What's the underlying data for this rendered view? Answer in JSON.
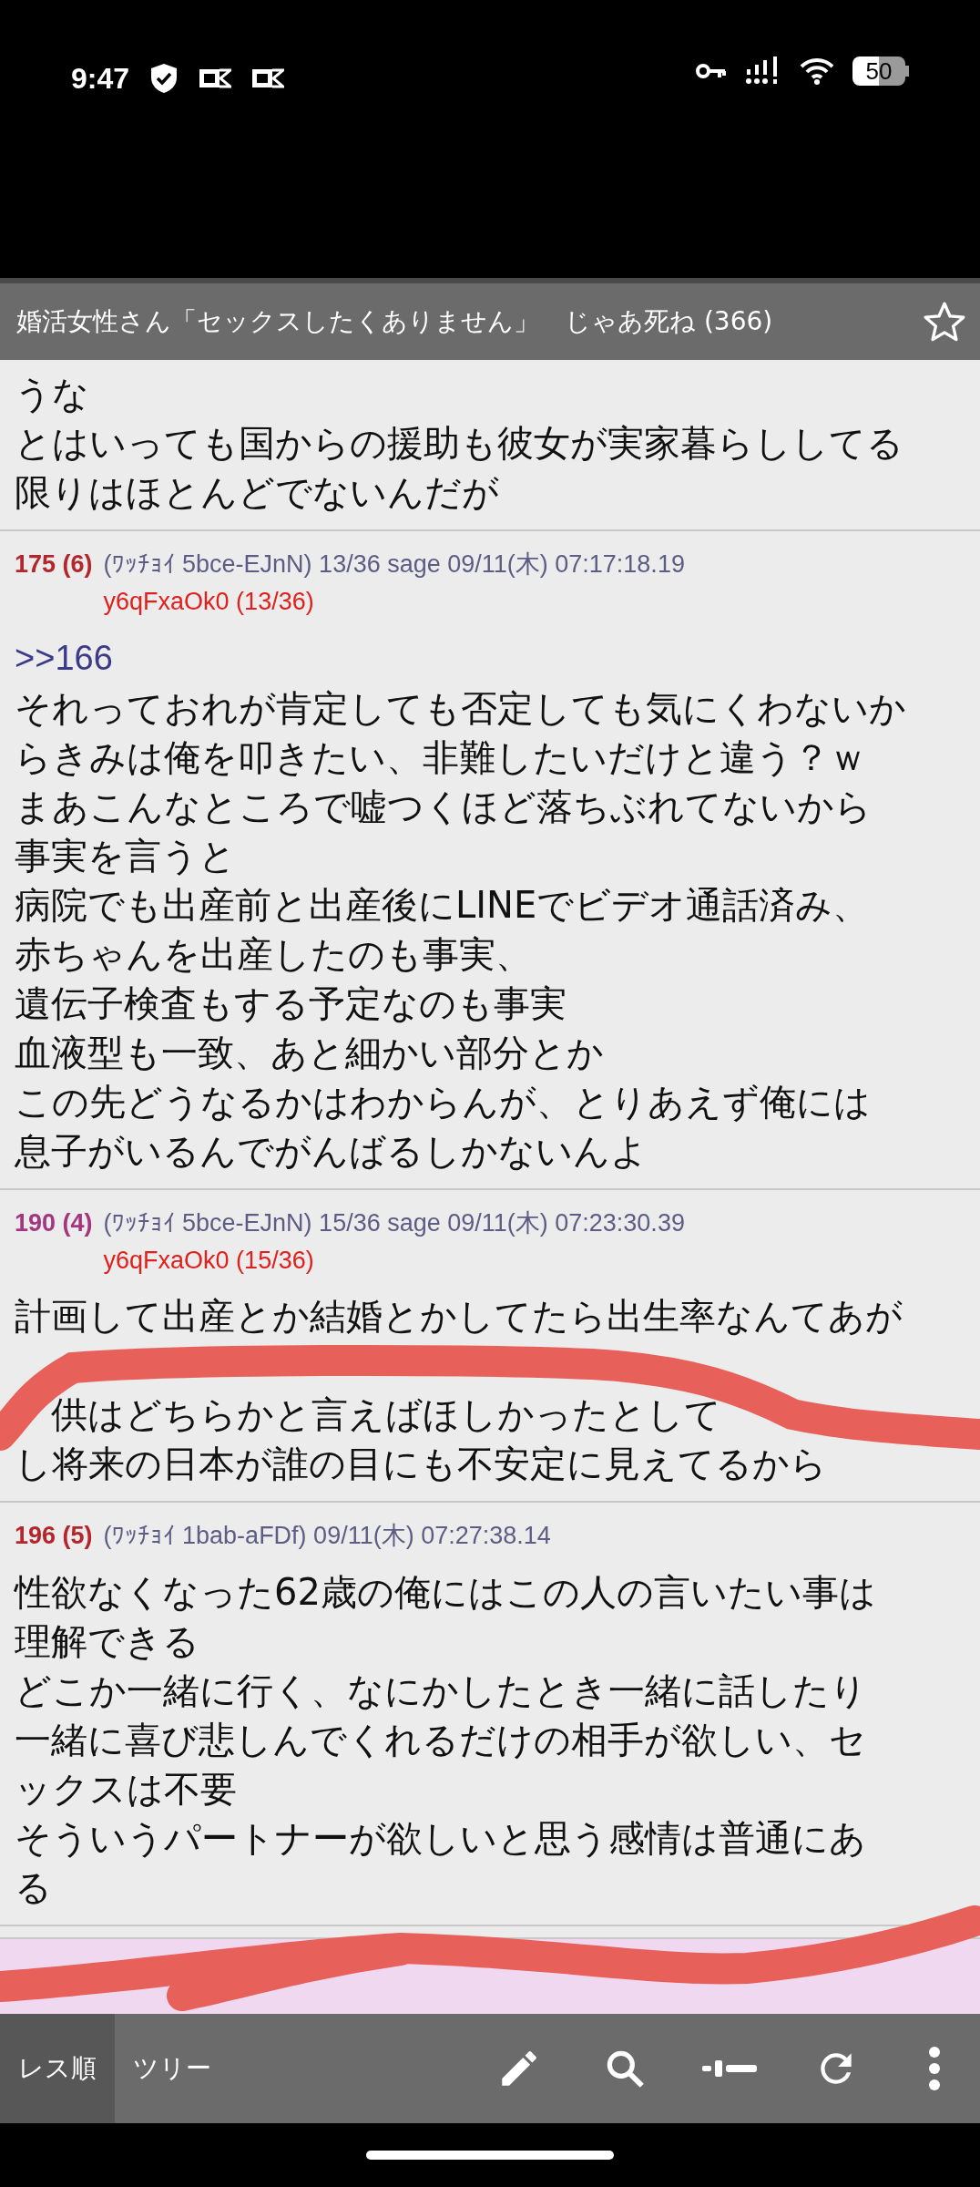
{
  "status_bar": {
    "time": "9:47",
    "battery": "50"
  },
  "thread": {
    "title": "婚活女性さん「セックスしたくありません」　じゃあ死ね (366)",
    "favorite": false
  },
  "posts": [
    {
      "partial": true,
      "lines": [
        "うな",
        "とはいっても国からの援助も彼女が実家暮らししてる",
        "限りはほとんどでないんだが"
      ]
    },
    {
      "number": "175 (6)",
      "color": "#b3262b",
      "meta": "(ﾜｯﾁｮｲ 5bce-EJnN) 13/36 sage 09/11(木) 07:17:18.19",
      "id": "y6qFxaOk0 (13/36)",
      "anchor": ">>166",
      "lines": [
        "それっておれが肯定しても否定しても気にくわないか",
        "らきみは俺を叩きたい、非難したいだけと違う？ｗ",
        "まあこんなところで嘘つくほど落ちぶれてないから",
        "事実を言うと",
        "病院でも出産前と出産後にLINEでビデオ通話済み、",
        "赤ちゃんを出産したのも事実、",
        "遺伝子検査もする予定なのも事実",
        "血液型も一致、あと細かい部分とか",
        "この先どうなるかはわからんが、とりあえず俺には",
        "息子がいるんでがんばるしかないんよ"
      ]
    },
    {
      "number": "190 (4)",
      "color": "#a3367e",
      "meta": "(ﾜｯﾁｮｲ 5bce-EJnN) 15/36 sage 09/11(木) 07:23:30.39",
      "id": "y6qFxaOk0 (15/36)",
      "lines": [
        "計画して出産とか結婚とかしてたら出生率なんてあが",
        {
          "covered": true
        },
        {
          "text": "供はどちらかと言えばほしかったとして",
          "lead_gap": true
        },
        "し将来の日本が誰の目にも不安定に見えてるから"
      ]
    },
    {
      "number": "196 (5)",
      "color": "#b3262b",
      "meta": "(ﾜｯﾁｮｲ 1bab-aFDf)  09/11(木) 07:27:38.14",
      "lines": [
        "性欲なくなった62歳の俺にはこの人の言いたい事は",
        "理解できる",
        "どこか一緒に行く、なにかしたとき一緒に話したり",
        "一緒に喜び悲しんでくれるだけの相手が欲しい、セ",
        "ックスは不要",
        "そういうパートナーが欲しいと思う感情は普通にあ",
        "る"
      ]
    }
  ],
  "tabs": [
    {
      "label": "レス順",
      "selected": true
    },
    {
      "label": "ツリー",
      "selected": false
    }
  ]
}
